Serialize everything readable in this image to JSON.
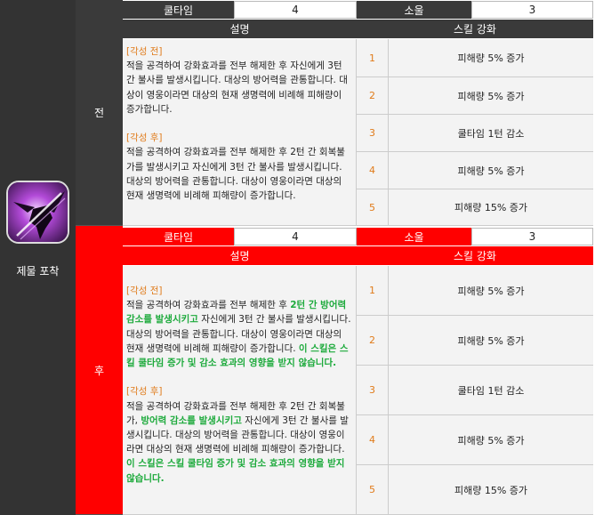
{
  "skill": {
    "name": "제물 포착",
    "icon": "winged-demon-skill-icon"
  },
  "labels": {
    "cooldown": "쿨타임",
    "soul": "소울",
    "description": "설명",
    "enhance": "스킬 강화"
  },
  "before": {
    "phase": "전",
    "cooldown_value": "4",
    "soul_value": "3",
    "awakening_before_title": "[각성 전]",
    "awakening_before_text": "적을 공격하여 강화효과를 전부 해제한 후 자신에게 3턴 간 불사를 발생시킵니다. 대상의 방어력을 관통합니다. 대상이 영웅이라면 대상의 현재 생명력에 비례해 피해량이 증가합니다.",
    "awakening_after_title": "[각성 후]",
    "awakening_after_text": "적을 공격하여 강화효과를 전부 해제한 후 2턴 간 회복불가를 발생시키고 자신에게 3턴 간 불사를 발생시킵니다. 대상의 방어력을 관통합니다. 대상이 영웅이라면 대상의 현재 생명력에 비례해 피해량이 증가합니다.",
    "levels": [
      {
        "num": "1",
        "text": "피해량 5% 증가"
      },
      {
        "num": "2",
        "text": "피해량 5% 증가"
      },
      {
        "num": "3",
        "text": "쿨타임 1턴 감소"
      },
      {
        "num": "4",
        "text": "피해량 5% 증가"
      },
      {
        "num": "5",
        "text": "피해량 15% 증가"
      }
    ]
  },
  "after": {
    "phase": "후",
    "cooldown_value": "4",
    "soul_value": "3",
    "awakening_before_title": "[각성 전]",
    "awakening_before_text_1": "적을 공격하여 강화효과를 전부 해제한 후 ",
    "awakening_before_highlight_1": "2턴 간 방어력 감소를 발생시키고",
    "awakening_before_text_2": " 자신에게 3턴 간 불사를 발생시킵니다. 대상의 방어력을 관통합니다. 대상이 영웅이라면 대상의 현재 생명력에 비례해 피해량이 증가합니다. ",
    "awakening_before_highlight_2": "이 스킬은 스킬 쿨타임 증가 및 감소 효과의 영향을 받지 않습니다.",
    "awakening_after_title": "[각성 후]",
    "awakening_after_text_1": "적을 공격하여 강화효과를 전부 해제한 후 2턴 간 회복불가, ",
    "awakening_after_highlight_1": "방어력 감소를 발생시키고",
    "awakening_after_text_2": " 자신에게 3턴 간 불사를 발생시킵니다. 대상의 방어력을 관통합니다. 대상이 영웅이라면 대상의 현재 생명력에 비례해 피해량이 증가합니다. ",
    "awakening_after_highlight_2": "이 스킬은 스킬 쿨타임 증가 및 감소 효과의 영향을 받지 않습니다.",
    "levels": [
      {
        "num": "1",
        "text": "피해량 5% 증가"
      },
      {
        "num": "2",
        "text": "피해량 5% 증가"
      },
      {
        "num": "3",
        "text": "쿨타임 1턴 감소"
      },
      {
        "num": "4",
        "text": "피해량 5% 증가"
      },
      {
        "num": "5",
        "text": "피해량 15% 증가"
      }
    ]
  },
  "colors": {
    "dark": "#3a3a3a",
    "red": "#ff0000",
    "orange": "#e07b1a",
    "green": "#1daa3c"
  }
}
